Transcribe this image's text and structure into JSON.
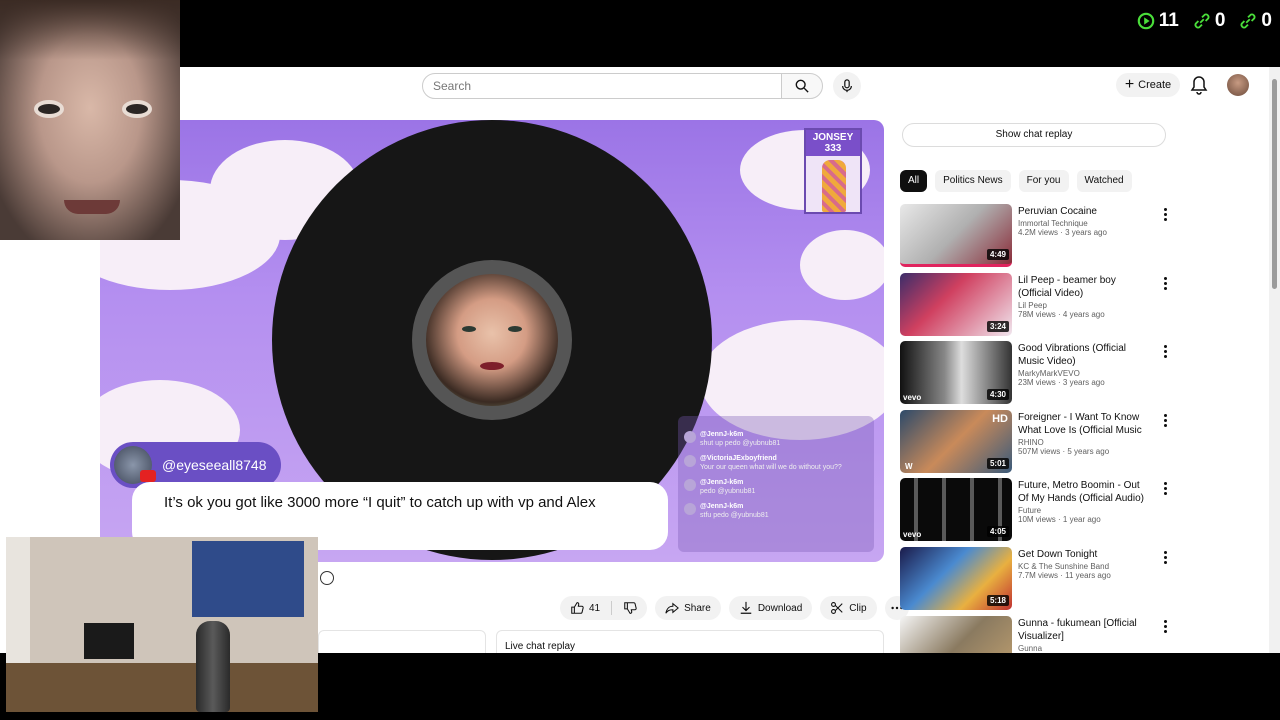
{
  "overlay_stats": [
    {
      "icon": "play-icon",
      "value": "11",
      "color": "#4ade3a"
    },
    {
      "icon": "link-icon",
      "value": "0",
      "color": "#4ade3a"
    },
    {
      "icon": "link-icon",
      "value": "0",
      "color": "#4ade3a"
    }
  ],
  "topbar": {
    "search_placeholder": "Search",
    "create_label": "Create"
  },
  "player": {
    "badge_text": "JONSEY 333",
    "username": "@eyeseeall8748",
    "comment": "It’s ok you got like 3000 more “I quit” to catch up with vp and Alex",
    "chat_overlay": {
      "header": "",
      "messages": [
        {
          "user": "@JennJ-k6m",
          "text": "shut up pedo @yubnub81"
        },
        {
          "user": "@VictoriaJExboyfriend",
          "text": "Your our queen what will we do without you??"
        },
        {
          "user": "@JennJ-k6m",
          "text": "pedo @yubnub81"
        },
        {
          "user": "@JennJ-k6m",
          "text": "stfu pedo @yubnub81"
        }
      ]
    }
  },
  "actions": {
    "like_count": "41",
    "share_label": "Share",
    "download_label": "Download",
    "clip_label": "Clip"
  },
  "live_chat_replay_label": "Live chat replay",
  "sidebar": {
    "show_chat_label": "Show chat replay",
    "chips": [
      "All",
      "Politics News",
      "For you",
      "Watched"
    ],
    "recommendations": [
      {
        "title": "Peruvian Cocaine",
        "channel": "Immortal Technique",
        "verified": true,
        "meta": "4.2M views · 3 years ago",
        "duration": "4:49",
        "thumb": "#8a2d3a"
      },
      {
        "title": "Lil Peep - beamer boy (Official Video)",
        "channel": "Lil Peep",
        "verified": true,
        "meta": "78M views · 4 years ago",
        "duration": "3:24",
        "thumb": "#6a4d8e"
      },
      {
        "title": "Good Vibrations (Official Music Video)",
        "channel": "MarkyMarkVEVO",
        "verified": true,
        "meta": "23M views · 3 years ago",
        "duration": "4:30",
        "thumb": "#4a4a4a"
      },
      {
        "title": "Foreigner - I Want To Know What Love Is (Official Music ...",
        "channel": "RHINO",
        "verified": true,
        "meta": "507M views · 5 years ago",
        "duration": "5:01",
        "thumb": "#3f5a7a"
      },
      {
        "title": "Future, Metro Boomin - Out Of My Hands (Official Audio)",
        "channel": "Future",
        "verified": true,
        "meta": "10M views · 1 year ago",
        "duration": "4:05",
        "thumb": "#1e1e1e"
      },
      {
        "title": "Get Down Tonight",
        "channel": "KC & The Sunshine Band",
        "verified": true,
        "meta": "7.7M views · 11 years ago",
        "duration": "5:18",
        "thumb": "#3a3f8a"
      },
      {
        "title": "Gunna - fukumean [Official Visualizer]",
        "channel": "Gunna",
        "verified": false,
        "meta": "",
        "duration": "",
        "thumb": "#8a7a60"
      }
    ]
  },
  "thumb_badges": {
    "hd": "HD",
    "vevo": "vevo",
    "w": "W"
  }
}
